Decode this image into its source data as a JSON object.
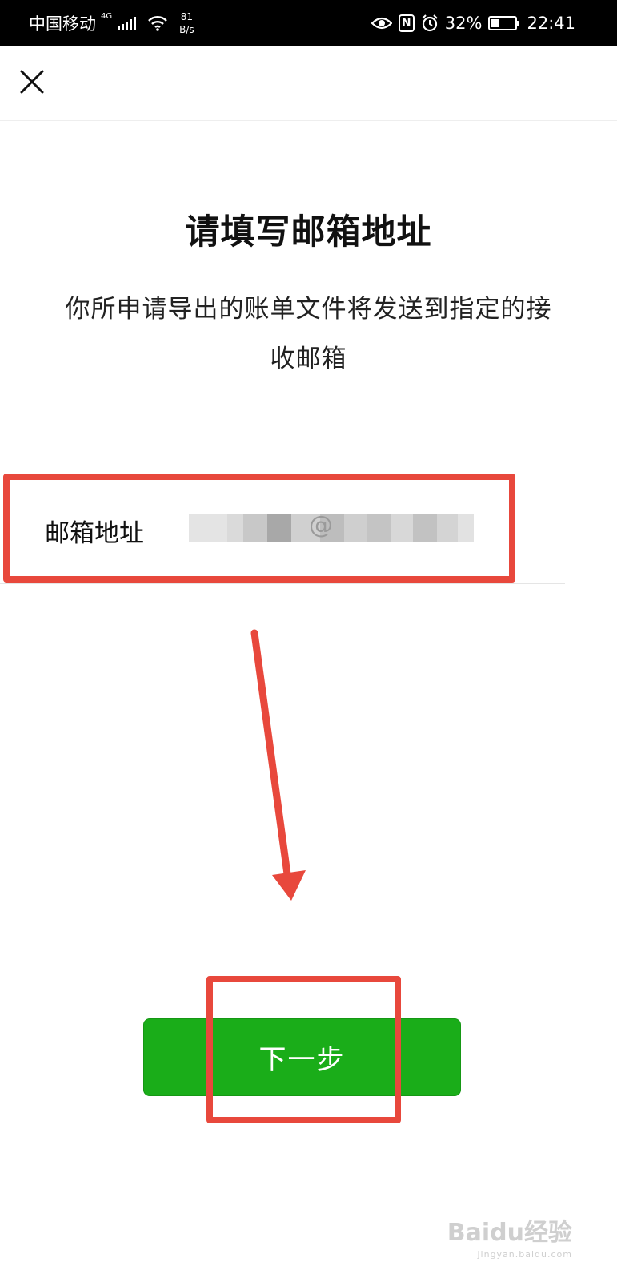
{
  "status_bar": {
    "carrier": "中国移动",
    "network": "4G",
    "speed_value": "81",
    "speed_unit": "B/s",
    "battery": "32%",
    "battery_level": 0.32,
    "time": "22:41"
  },
  "header": {
    "close_icon": "close-icon"
  },
  "page": {
    "title": "请填写邮箱地址",
    "description": "你所申请导出的账单文件将发送到指定的接收邮箱"
  },
  "email": {
    "label": "邮箱地址",
    "value_visible_fragment": "@"
  },
  "next_button": {
    "label": "下一步"
  },
  "watermark": {
    "text": "Baidu经验",
    "sub": "jingyan.baidu.com"
  },
  "colors": {
    "primary_green": "#1aad19",
    "annotation_red": "#e8483c",
    "status_bar": "#000000"
  },
  "icons": [
    "close-icon",
    "wifi-icon",
    "signal-icon",
    "eye-icon",
    "nfc-icon",
    "alarm-icon",
    "battery-icon"
  ]
}
